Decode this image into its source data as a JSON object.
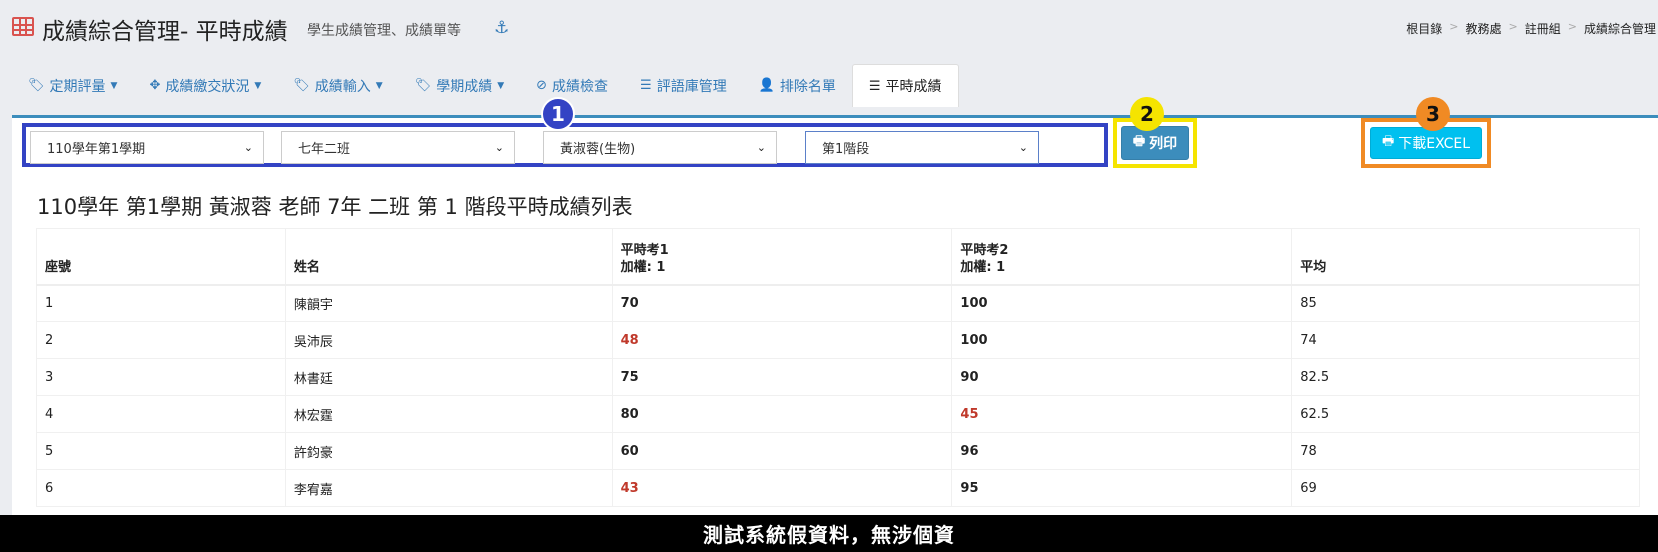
{
  "header": {
    "title": "成績綜合管理- 平時成績",
    "subtitle": "學生成績管理、成績單等",
    "breadcrumb": [
      "根目錄",
      "教務處",
      "註冊組",
      "成績綜合管理"
    ]
  },
  "tabs": [
    {
      "label": "定期評量",
      "icon": "tags-icon",
      "dropdown": true
    },
    {
      "label": "成績繳交狀況",
      "icon": "crosshairs-icon",
      "dropdown": true
    },
    {
      "label": "成績輸入",
      "icon": "tags-icon",
      "dropdown": true
    },
    {
      "label": "學期成績",
      "icon": "tags-icon",
      "dropdown": true
    },
    {
      "label": "成績檢查",
      "icon": "check-circle-icon",
      "dropdown": false
    },
    {
      "label": "評語庫管理",
      "icon": "database-icon",
      "dropdown": false
    },
    {
      "label": "排除名單",
      "icon": "user-times-icon",
      "dropdown": false
    },
    {
      "label": "平時成績",
      "icon": "database-icon",
      "dropdown": false,
      "active": true
    }
  ],
  "filters": {
    "semester": "110學年第1學期",
    "class": "七年二班",
    "teacher": "黃淑蓉(生物)",
    "stage": "第1階段"
  },
  "markers": [
    "1",
    "2",
    "3"
  ],
  "buttons": {
    "print": "列印",
    "excel": "下載EXCEL"
  },
  "list_title": "110學年 第1學期 黃淑蓉 老師 7年 二班 第 1 階段平時成績列表",
  "table": {
    "headers": {
      "seat": "座號",
      "name": "姓名",
      "q1": "平時考1",
      "q1_weight": "加權: 1",
      "q2": "平時考2",
      "q2_weight": "加權: 1",
      "avg": "平均"
    },
    "rows": [
      {
        "seat": "1",
        "name": "陳韻宇",
        "q1": "70",
        "q2": "100",
        "avg": "85",
        "q1_fail": false,
        "q2_fail": false
      },
      {
        "seat": "2",
        "name": "吳沛辰",
        "q1": "48",
        "q2": "100",
        "avg": "74",
        "q1_fail": true,
        "q2_fail": false
      },
      {
        "seat": "3",
        "name": "林書廷",
        "q1": "75",
        "q2": "90",
        "avg": "82.5",
        "q1_fail": false,
        "q2_fail": false
      },
      {
        "seat": "4",
        "name": "林宏霆",
        "q1": "80",
        "q2": "45",
        "avg": "62.5",
        "q1_fail": false,
        "q2_fail": true
      },
      {
        "seat": "5",
        "name": "許鈞豪",
        "q1": "60",
        "q2": "96",
        "avg": "78",
        "q1_fail": false,
        "q2_fail": false
      },
      {
        "seat": "6",
        "name": "李宥嘉",
        "q1": "43",
        "q2": "95",
        "avg": "69",
        "q1_fail": true,
        "q2_fail": false
      }
    ]
  },
  "disclaimer": "測試系統假資料，無涉個資",
  "colors": {
    "fail": "#c0392b",
    "link": "#337ab7",
    "marker1": "#3343c4",
    "marker2": "#f5e400",
    "marker3": "#f08a24"
  }
}
